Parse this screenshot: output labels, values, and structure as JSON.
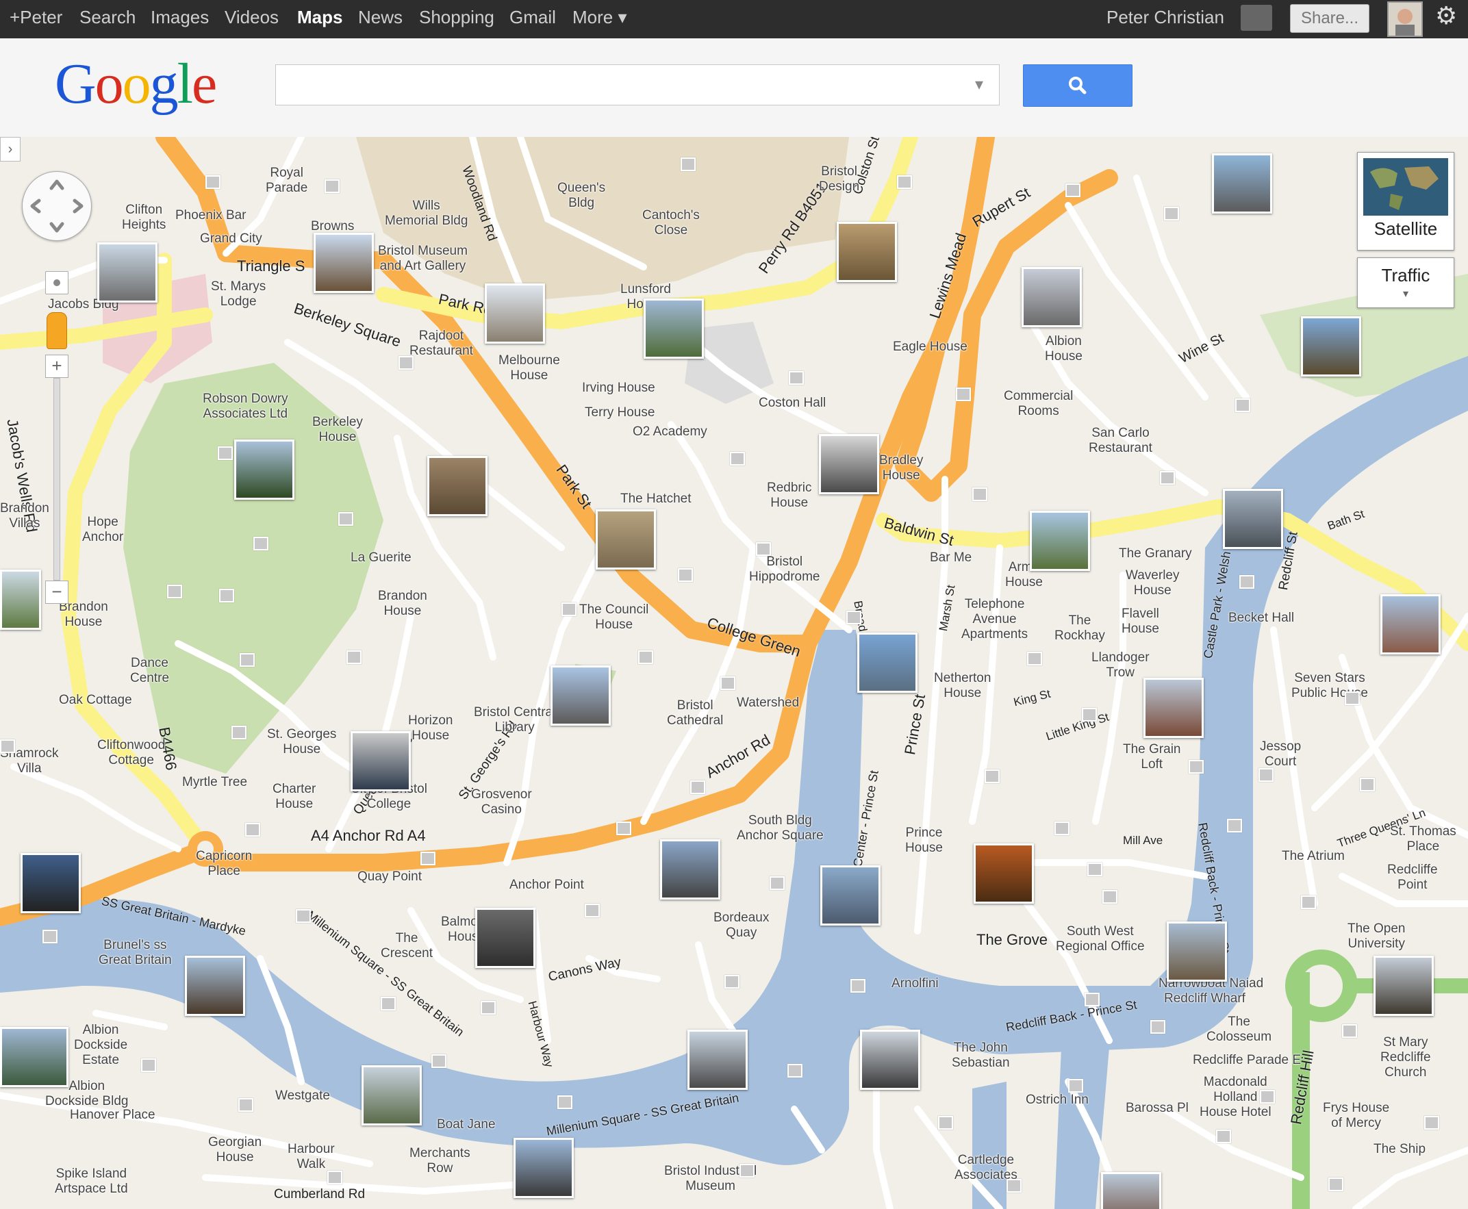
{
  "nav": {
    "items": [
      {
        "label": "+Peter",
        "active": false
      },
      {
        "label": "Search",
        "active": false
      },
      {
        "label": "Images",
        "active": false
      },
      {
        "label": "Videos",
        "active": false
      },
      {
        "label": "Maps",
        "active": true
      },
      {
        "label": "News",
        "active": false
      },
      {
        "label": "Shopping",
        "active": false
      },
      {
        "label": "Gmail",
        "active": false
      },
      {
        "label": "More ▾",
        "active": false
      }
    ],
    "user_name": "Peter Christian",
    "share_label": "Share...",
    "gear_icon": "gear-icon"
  },
  "header": {
    "logo_letters": [
      {
        "ch": "G",
        "color": "#1a56d6"
      },
      {
        "ch": "o",
        "color": "#d62d20"
      },
      {
        "ch": "o",
        "color": "#f4b400"
      },
      {
        "ch": "g",
        "color": "#1a56d6"
      },
      {
        "ch": "l",
        "color": "#109d58"
      },
      {
        "ch": "e",
        "color": "#d62d20"
      }
    ],
    "search_value": "",
    "search_placeholder": "",
    "search_icon": "magnifier-icon",
    "dropdown_glyph": "▾"
  },
  "map_controls": {
    "pan_icon": "pan-control-icon",
    "zoom_in": "+",
    "zoom_out": "−",
    "satellite_label": "Satellite",
    "traffic_label": "Traffic",
    "traffic_caret": "▾",
    "collapse_glyph": "›"
  },
  "road_labels": [
    {
      "text": "Triangle S"
    },
    {
      "text": "Berkeley Square"
    },
    {
      "text": "Park St"
    },
    {
      "text": "Park Rd"
    },
    {
      "text": "Perry Rd  B4051"
    },
    {
      "text": "Lewins Mead"
    },
    {
      "text": "Rupert St"
    },
    {
      "text": "Baldwin St"
    },
    {
      "text": "College Green"
    },
    {
      "text": "Anchor Rd"
    },
    {
      "text": "A4   Anchor Rd   A4"
    },
    {
      "text": "Jacob's Wells Rd"
    },
    {
      "text": "B4466"
    },
    {
      "text": "Prince St"
    },
    {
      "text": "The Grove"
    },
    {
      "text": "Redcliff Hill"
    },
    {
      "text": "Broad Quay"
    },
    {
      "text": "Colston St"
    },
    {
      "text": "Woodland Rd"
    },
    {
      "text": "Queen's Parade"
    },
    {
      "text": "St. George's Rd"
    },
    {
      "text": "Canons Way"
    },
    {
      "text": "Cumberland Rd"
    },
    {
      "text": "Harbour Way"
    },
    {
      "text": "Wine St"
    },
    {
      "text": "Bath St"
    },
    {
      "text": "Redcliff St"
    },
    {
      "text": "Three Queens' Ln"
    },
    {
      "text": "Marsh St"
    },
    {
      "text": "Little King St"
    },
    {
      "text": "King St"
    },
    {
      "text": "Mill Ave"
    }
  ],
  "place_labels": [
    {
      "text": "Royal\nParade"
    },
    {
      "text": "Clifton\nHeights"
    },
    {
      "text": "Phoenix Bar"
    },
    {
      "text": "Grand City"
    },
    {
      "text": "Browns"
    },
    {
      "text": "Wills\nMemorial Bldg"
    },
    {
      "text": "Queen's\nBldg"
    },
    {
      "text": "Cantoch's\nClose"
    },
    {
      "text": "Bristol\nDesign"
    },
    {
      "text": "Bristol Museum\nand Art Gallery"
    },
    {
      "text": "St. Marys\nLodge"
    },
    {
      "text": "Jacobs Bldg"
    },
    {
      "text": "Rajdoot\nRestaurant"
    },
    {
      "text": "Melbourne\nHouse"
    },
    {
      "text": "Lunsford\nHouse"
    },
    {
      "text": "Irving House"
    },
    {
      "text": "Terry House"
    },
    {
      "text": "O2 Academy"
    },
    {
      "text": "Coston Hall"
    },
    {
      "text": "Eagle House"
    },
    {
      "text": "Albion\nHouse"
    },
    {
      "text": "Commercial\nRooms"
    },
    {
      "text": "San Carlo\nRestaurant"
    },
    {
      "text": "Robson Dowry\nAssociates Ltd"
    },
    {
      "text": "Berkeley\nHouse"
    },
    {
      "text": "Bradley\nHouse"
    },
    {
      "text": "Redbric\nHouse"
    },
    {
      "text": "The Hatchet"
    },
    {
      "text": "Brandon\nVillas"
    },
    {
      "text": "Hope\nAnchor"
    },
    {
      "text": "La Guerite"
    },
    {
      "text": "Brandon\nHouse"
    },
    {
      "text": "Brandon\nHouse"
    },
    {
      "text": "Bristol\nHippodrome"
    },
    {
      "text": "Bar Me"
    },
    {
      "text": "Arma\nHouse"
    },
    {
      "text": "The Granary"
    },
    {
      "text": "Waverley\nHouse"
    },
    {
      "text": "Telephone\nAvenue\nApartments"
    },
    {
      "text": "The\nRockhay"
    },
    {
      "text": "Flavell\nHouse"
    },
    {
      "text": "Becket Hall"
    },
    {
      "text": "The Council\nHouse"
    },
    {
      "text": "Dance\nCentre"
    },
    {
      "text": "Oak Cottage"
    },
    {
      "text": "Bristol\nCathedral"
    },
    {
      "text": "Watershed"
    },
    {
      "text": "Netherton\nHouse"
    },
    {
      "text": "Llandoger\nTrow"
    },
    {
      "text": "Seven Stars\nPublic House"
    },
    {
      "text": "Shamrock\nVilla"
    },
    {
      "text": "Cliftonwood\nCottage"
    },
    {
      "text": "St. Georges\nHouse"
    },
    {
      "text": "Horizon\nHouse"
    },
    {
      "text": "Bristol Central\nLibrary"
    },
    {
      "text": "The Grain\nLoft"
    },
    {
      "text": "Jessop\nCourt"
    },
    {
      "text": "Myrtle Tree"
    },
    {
      "text": "Charter\nHouse"
    },
    {
      "text": "City of Bristol\nCollege"
    },
    {
      "text": "Grosvenor\nCasino"
    },
    {
      "text": "South Bldg\nAnchor Square"
    },
    {
      "text": "Prince\nHouse"
    },
    {
      "text": "St. Thomas\nPlace"
    },
    {
      "text": "The Atrium"
    },
    {
      "text": "Redcliffe\nPoint"
    },
    {
      "text": "Capricorn\nPlace"
    },
    {
      "text": "Quay Point"
    },
    {
      "text": "Anchor Point"
    },
    {
      "text": "Bordeaux\nQuay"
    },
    {
      "text": "Balmoral\nHouse"
    },
    {
      "text": "The\nCrescent"
    },
    {
      "text": "Brunel's ss\nGreat Britain"
    },
    {
      "text": "South West\nRegional Office"
    },
    {
      "text": "The Open\nUniversity"
    },
    {
      "text": "Arnolfini"
    },
    {
      "text": "Narrowboat Naiad"
    },
    {
      "text": "Redcliff Wharf"
    },
    {
      "text": "The\nColosseum"
    },
    {
      "text": "Albion\nDockside\nEstate"
    },
    {
      "text": "Albion\nDockside Bldg"
    },
    {
      "text": "Hanover Place"
    },
    {
      "text": "Westgate"
    },
    {
      "text": "The John\nSebastian"
    },
    {
      "text": "Redcliffe Parade E"
    },
    {
      "text": "Macdonald\nHolland\nHouse Hotel"
    },
    {
      "text": "St Mary\nRedcliffe\nChurch"
    },
    {
      "text": "Ostrich Inn"
    },
    {
      "text": "Barossa Pl"
    },
    {
      "text": "Frys House\nof Mercy"
    },
    {
      "text": "Boat Jane"
    },
    {
      "text": "Georgian\nHouse"
    },
    {
      "text": "Harbour\nWalk"
    },
    {
      "text": "Merchants\nRow"
    },
    {
      "text": "Bristol Industrial\nMuseum"
    },
    {
      "text": "Spike Island\nArtspace Ltd"
    },
    {
      "text": "Cartledge\nAssociates"
    },
    {
      "text": "The Ship"
    }
  ],
  "water_labels": [
    {
      "text": "SS Great Britain - Mardyke"
    },
    {
      "text": "Millenium Square - SS Great Britain"
    },
    {
      "text": "Millenium Square - SS Great Britain"
    },
    {
      "text": "City Center - Prince St"
    },
    {
      "text": "Redcliff Back - Prince St"
    },
    {
      "text": "Castle Park - Welsh Back"
    },
    {
      "text": "Redcliff Back - Prince St"
    }
  ],
  "colors": {
    "land": "#f1efe8",
    "water": "#a5bfdd",
    "park": "#c9dfaf",
    "major_road": "#f9b04c",
    "secondary_road": "#fbf28a",
    "minor_road": "#ffffff",
    "building": "#e6dcc6"
  },
  "photo_icons": "photo-thumbnail"
}
